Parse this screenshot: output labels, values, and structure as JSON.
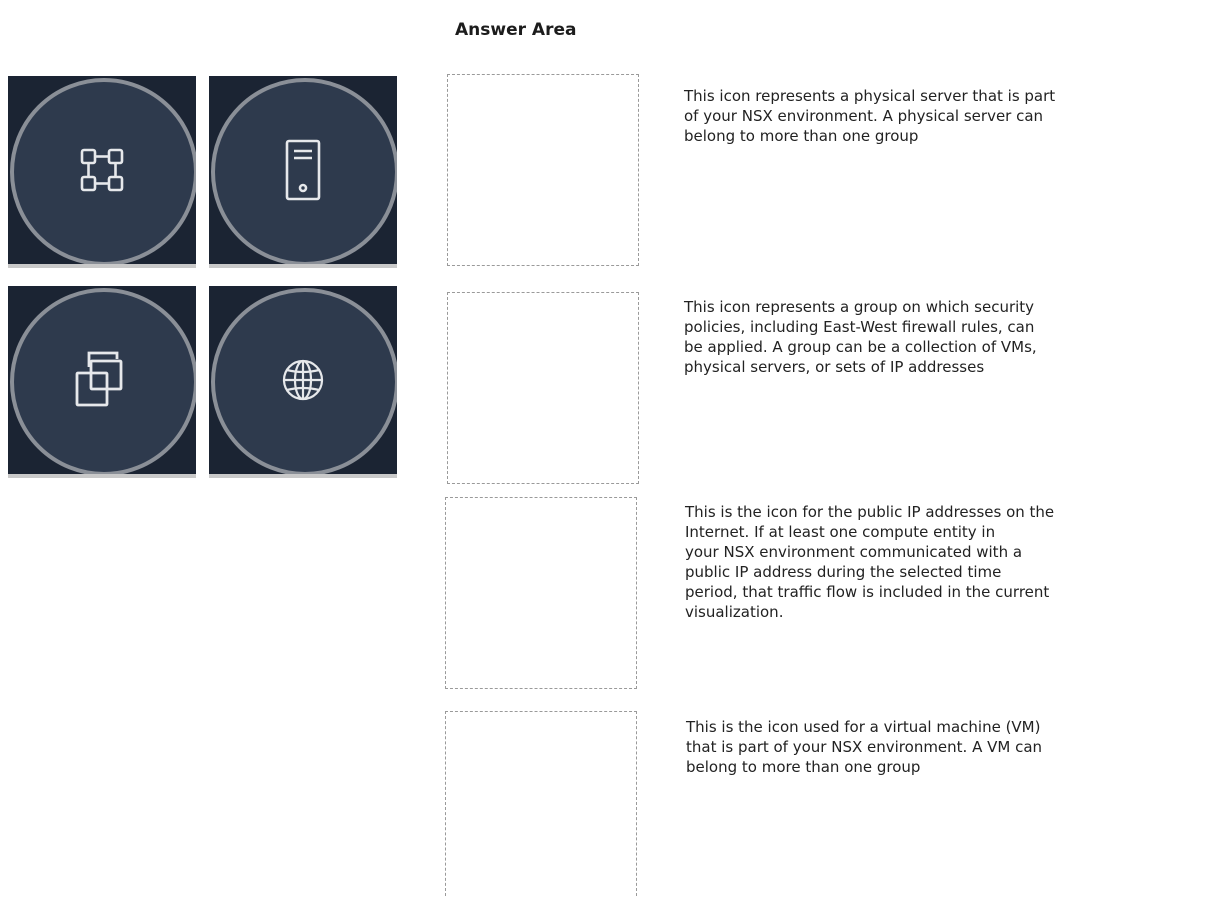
{
  "answer_area": {
    "title": "Answer Area"
  },
  "icon_tiles": [
    {
      "icon": "group-icon"
    },
    {
      "icon": "physical-server-icon"
    },
    {
      "icon": "virtual-machine-icon"
    },
    {
      "icon": "internet-globe-icon"
    }
  ],
  "statements": [
    {
      "text": "This icon represents a physical server that is part\nof your NSX environment. A physical server can\nbelong to more than one group"
    },
    {
      "text": "This icon represents a group on which security\npolicies, including East-West firewall rules, can\nbe applied. A group can be a collection of VMs,\nphysical servers, or sets of IP addresses"
    },
    {
      "text": "This is the icon for the public IP addresses on the\nInternet. If at least one compute entity in\nyour NSX environment communicated with a\npublic IP address during the selected time\nperiod, that traffic flow is included in the current\nvisualization."
    },
    {
      "text": "This is the icon used for a virtual machine (VM)\nthat is part of your NSX environment. A VM can\nbelong to more than one group"
    }
  ],
  "colors": {
    "tile_background": "#1b2433",
    "disc_fill": "#2e3a4d",
    "disc_ring": "#8a8f97",
    "icon_stroke": "#e6e8eb"
  }
}
